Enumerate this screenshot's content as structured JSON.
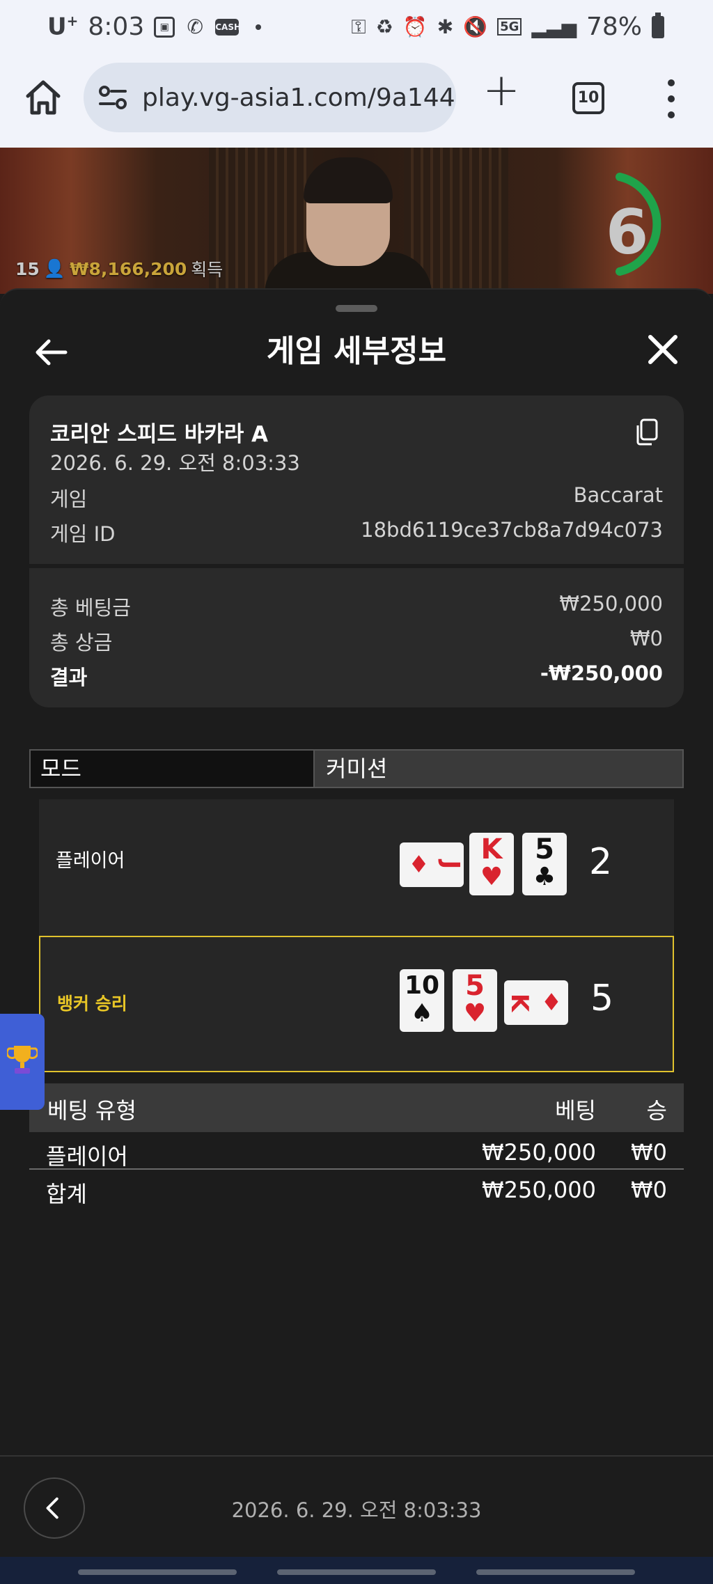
{
  "status_bar": {
    "carrier": "U",
    "carrier_sup": "+",
    "time": "8:03",
    "app_badge": "CASH",
    "network": "5G",
    "battery": "78%"
  },
  "browser": {
    "url": "play.vg-asia1.com/9a144",
    "tab_count": "10"
  },
  "video": {
    "player_count": "15",
    "winnings_amount": "₩8,166,200",
    "winnings_label": "획득",
    "countdown": "6"
  },
  "sheet": {
    "title": "게임 세부정보"
  },
  "game_card": {
    "table_name": "코리안 스피드 바카라 A",
    "datetime": "2026. 6. 29. 오전 8:03:33",
    "game_label": "게임",
    "game_value": "Baccarat",
    "game_id_label": "게임 ID",
    "game_id_value": "18bd6119ce37cb8a7d94c073",
    "total_bet_label": "총 베팅금",
    "total_bet_value": "₩250,000",
    "total_win_label": "총 상금",
    "total_win_value": "₩0",
    "result_label": "결과",
    "result_value": "-₩250,000"
  },
  "mode_bar": {
    "mode_label": "모드",
    "mode_value": "커미션"
  },
  "hands": {
    "player": {
      "label": "플레이어",
      "score": "2",
      "cards": [
        {
          "rank": "J",
          "suit": "♦",
          "color": "red",
          "orientation": "horizontal"
        },
        {
          "rank": "K",
          "suit": "♥",
          "color": "red",
          "orientation": "vertical"
        },
        {
          "rank": "5",
          "suit": "♣",
          "color": "black",
          "orientation": "vertical"
        }
      ]
    },
    "banker": {
      "label": "뱅커 승리",
      "score": "5",
      "cards": [
        {
          "rank": "10",
          "suit": "♠",
          "color": "black",
          "orientation": "vertical"
        },
        {
          "rank": "5",
          "suit": "♥",
          "color": "red",
          "orientation": "vertical"
        },
        {
          "rank": "K",
          "suit": "♦",
          "color": "red",
          "orientation": "horizontal"
        }
      ],
      "highlight_color": "#e0c22d"
    }
  },
  "bets_table": {
    "headers": {
      "type": "베팅 유형",
      "bet": "베팅",
      "win": "승"
    },
    "rows": [
      {
        "type": "플레이어",
        "bet": "₩250,000",
        "win": "₩0"
      }
    ],
    "total": {
      "type": "합계",
      "bet": "₩250,000",
      "win": "₩0"
    }
  },
  "footer": {
    "datetime": "2026. 6. 29. 오전 8:03:33"
  },
  "colors": {
    "background": "#1c1c1c",
    "card_bg": "#2a2a2a",
    "gold": "#e0c22d",
    "countdown_ring": "#1fa34a",
    "trophy_tab": "#3f5fd6"
  }
}
